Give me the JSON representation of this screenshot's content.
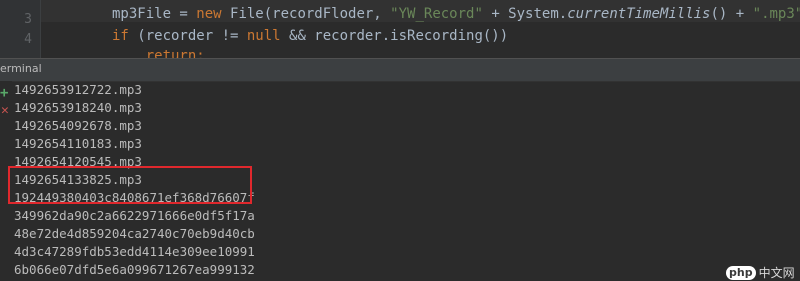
{
  "editor": {
    "line_numbers": [
      "",
      "3",
      "4"
    ],
    "lines": [
      {
        "text": "mp3File = new File(recordFloder, \"YW_Record\" + System.currentTimeMillis() + \".mp3\");"
      },
      {
        "text": "if (recorder != null && recorder.isRecording())"
      },
      {
        "text": "    return;"
      }
    ]
  },
  "terminal": {
    "title": "erminal",
    "plus_icon": "+",
    "close_icon": "✕",
    "lines": [
      "1492653912722.mp3",
      "1492653918240.mp3",
      "1492654092678.mp3",
      "1492654110183.mp3",
      "1492654120545.mp3",
      "1492654133825.mp3",
      "192449380403c8408671ef368d76607f",
      "349962da90c2a6622971666e0df5f17a",
      "48e72de4d859204ca2740c70eb9d40cb",
      "4d3c47289fdb53edd4114e309ee10991",
      "6b066e07dfd5e6a099671267ea999132"
    ],
    "highlight_color": "#e0282d"
  },
  "watermark": {
    "badge": "php",
    "text": "中文网"
  }
}
